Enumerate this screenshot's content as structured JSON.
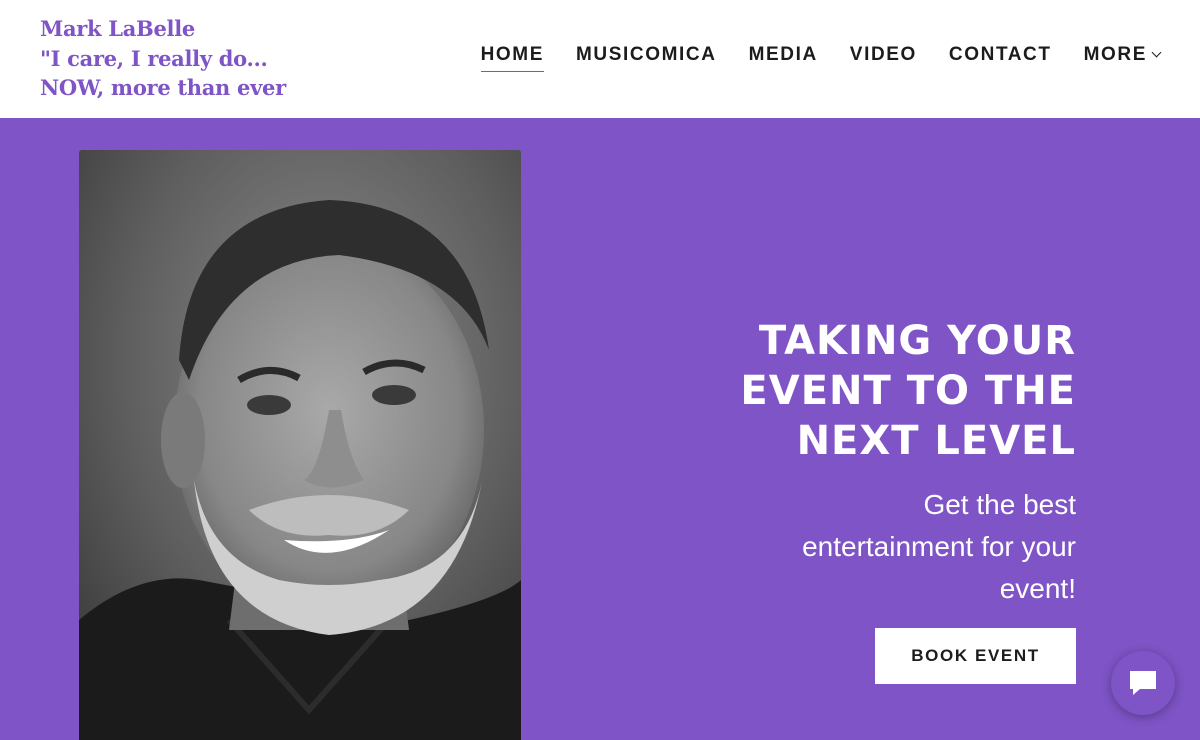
{
  "brand": {
    "lines": [
      "Mark LaBelle",
      "\"I care, I really do...",
      "NOW, more than ever"
    ],
    "color": "#7e54c6"
  },
  "nav": {
    "items": [
      "HOME",
      "MUSICOMICA",
      "MEDIA",
      "VIDEO",
      "CONTACT"
    ],
    "more_label": "MORE",
    "active": "HOME"
  },
  "hero": {
    "headline": "TAKING YOUR EVENT TO THE NEXT LEVEL",
    "headline_lines": [
      "TAKING YOUR",
      "EVENT TO THE",
      "NEXT LEVEL"
    ],
    "subhead_lines": [
      "Get the best",
      "entertainment for your",
      "event!"
    ],
    "cta_label": "BOOK EVENT",
    "background": "#7e54c6",
    "portrait_icon": "portrait-photo"
  },
  "chat": {
    "icon": "chat-bubble-icon"
  }
}
